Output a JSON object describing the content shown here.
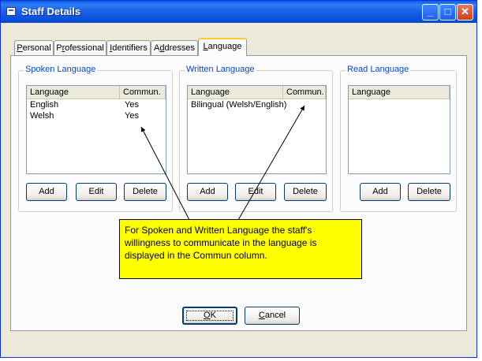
{
  "window": {
    "title": "Staff Details"
  },
  "tabs": [
    {
      "label": "Personal",
      "accel": "P",
      "rest": "ersonal"
    },
    {
      "label": "Professional",
      "accel": "r",
      "pre": "P",
      "rest": "ofessional"
    },
    {
      "label": "Identifiers",
      "accel": "I",
      "rest": "dentifiers"
    },
    {
      "label": "Addresses",
      "accel": "d",
      "pre": "A",
      "rest": "dresses"
    },
    {
      "label": "Language",
      "accel": "L",
      "rest": "anguage",
      "active": true
    }
  ],
  "spoken": {
    "label": "Spoken Language",
    "columns": [
      "Language",
      "Commun."
    ],
    "rows": [
      {
        "language": "English",
        "commun": "Yes"
      },
      {
        "language": "Welsh",
        "commun": "Yes"
      }
    ],
    "buttons": {
      "add": "Add",
      "edit": "Edit",
      "delete": "Delete"
    }
  },
  "written": {
    "label": "Written Language",
    "columns": [
      "Language",
      "Commun."
    ],
    "rows": [
      {
        "language": "Bilingual (Welsh/English)",
        "commun": ""
      }
    ],
    "buttons": {
      "add": "Add",
      "edit": "Edit",
      "delete": "Delete"
    }
  },
  "read": {
    "label": "Read Language",
    "columns": [
      "Language"
    ],
    "rows": [],
    "buttons": {
      "add": "Add",
      "delete": "Delete"
    }
  },
  "footer": {
    "ok": {
      "accel": "O",
      "rest": "K"
    },
    "cancel": {
      "accel": "C",
      "rest": "ancel"
    }
  },
  "annotation": {
    "text": "For Spoken and Written Language the staff's willingness to communicate in the language is displayed in the Commun column."
  },
  "colors": {
    "title_bar": "#0a5fe8",
    "dialog_bg": "#ece9d8",
    "note_bg": "#ffff00",
    "group_label": "#0046d5"
  }
}
